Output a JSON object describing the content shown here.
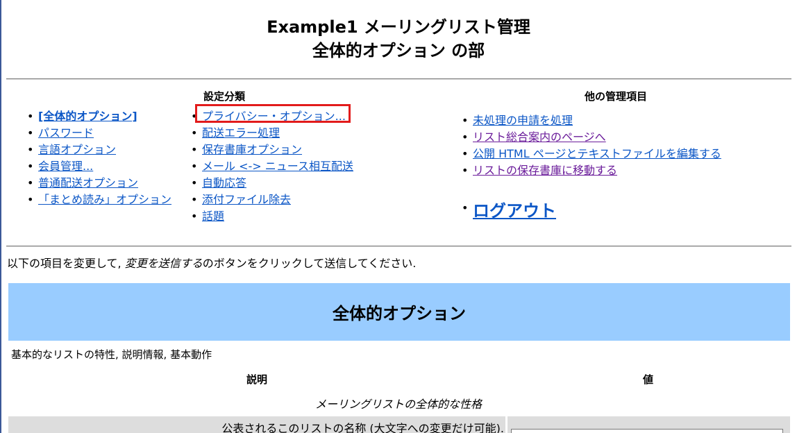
{
  "header": {
    "title_line1": "Example1 メーリングリスト管理",
    "title_line2": "全体的オプション の部"
  },
  "categories": {
    "heading": "設定分類",
    "col1": [
      {
        "label": "[全体的オプション]",
        "current": true
      },
      {
        "label": "パスワード"
      },
      {
        "label": "言語オプション"
      },
      {
        "label": "会員管理..."
      },
      {
        "label": "普通配送オプション"
      },
      {
        "label": "「まとめ読み」オプション"
      }
    ],
    "col2": [
      {
        "label": "プライバシー・オプション..."
      },
      {
        "label": "配送エラー処理"
      },
      {
        "label": "保存書庫オプション"
      },
      {
        "label": "メール <-> ニュース相互配送"
      },
      {
        "label": "自動応答"
      },
      {
        "label": "添付ファイル除去"
      },
      {
        "label": "話題"
      }
    ]
  },
  "other_admin": {
    "heading": "他の管理項目",
    "items": [
      {
        "label": "未処理の申請を処理"
      },
      {
        "label": "リスト総合案内のページへ"
      },
      {
        "label": "公開 HTML ページとテキストファイルを編集する"
      },
      {
        "label": "リストの保存書庫に移動する"
      }
    ],
    "logout": "ログアウト"
  },
  "instructions": {
    "before": "以下の項目を変更して, ",
    "emph": "変更を送信する",
    "after": "のボタンをクリックして送信してください."
  },
  "section": {
    "title": "全体的オプション",
    "description": "基本的なリストの特性, 説明情報, 基本動作",
    "col_description": "説明",
    "col_value": "値",
    "subsection": "メーリングリストの全体的な性格",
    "first_row_label": "公表されるこのリストの名称 (大文字への変更だけ可能)."
  },
  "colors": {
    "link": "#0b56c6",
    "visited_link": "#6a1b9a",
    "section_band": "#99ccff",
    "highlight": "#e21b1b"
  }
}
